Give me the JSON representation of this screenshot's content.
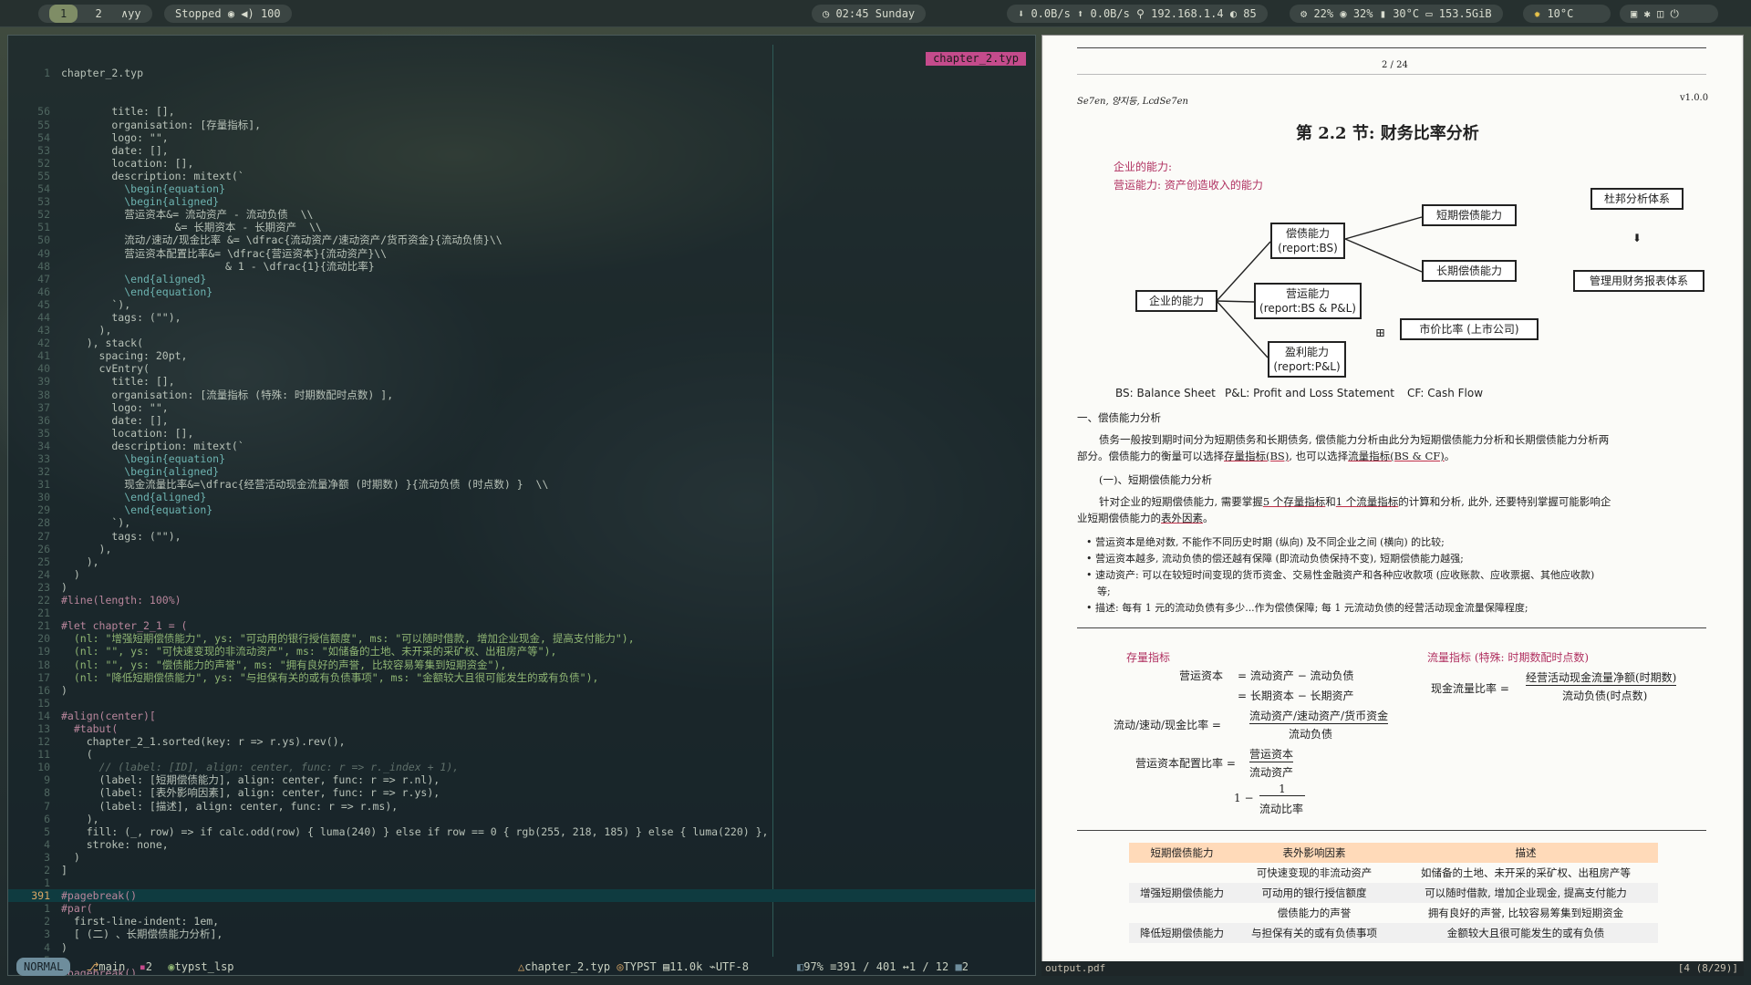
{
  "topbar": {
    "workspaces": [
      "1",
      "2"
    ],
    "layout": "∧yy",
    "music": {
      "status": "Stopped",
      "volume": "100"
    },
    "clock": "02:45 Sunday",
    "network": {
      "down": "0.0B/s",
      "up": "0.0B/s",
      "ip": "192.168.1.4",
      "battery": "85"
    },
    "system": {
      "cpu": "22%",
      "mem": "32%",
      "temp": "30°C",
      "disk": "153.5GiB"
    },
    "weather": "10°C"
  },
  "editor": {
    "filename": "chapter_2.typ",
    "first_line": "chapter_2.typ",
    "lines": [
      {
        "n": "56",
        "t": "        title: [],"
      },
      {
        "n": "55",
        "t": "        organisation: [存量指标],"
      },
      {
        "n": "54",
        "t": "        logo: \"\","
      },
      {
        "n": "53",
        "t": "        date: [],"
      },
      {
        "n": "52",
        "t": "        location: [],"
      },
      {
        "n": "55",
        "t": "        description: mitext(`"
      },
      {
        "n": "54",
        "t": "          \\begin{equation}"
      },
      {
        "n": "53",
        "t": "          \\begin{aligned}"
      },
      {
        "n": "52",
        "t": "          营运资本&= 流动资产 - 流动负债  \\\\"
      },
      {
        "n": "51",
        "t": "                  &= 长期资本 - 长期资产  \\\\"
      },
      {
        "n": "50",
        "t": "          流动/速动/现金比率 &= \\dfrac{流动资产/速动资产/货币资金}{流动负债}\\\\"
      },
      {
        "n": "49",
        "t": "          营运资本配置比率&= \\dfrac{营运资本}{流动资产}\\\\"
      },
      {
        "n": "48",
        "t": "                          & 1 - \\dfrac{1}{流动比率}"
      },
      {
        "n": "47",
        "t": "          \\end{aligned}"
      },
      {
        "n": "46",
        "t": "          \\end{equation}"
      },
      {
        "n": "45",
        "t": "        `),"
      },
      {
        "n": "44",
        "t": "        tags: (\"\"),"
      },
      {
        "n": "43",
        "t": "      ),"
      },
      {
        "n": "42",
        "t": "    ), stack("
      },
      {
        "n": "41",
        "t": "      spacing: 20pt,"
      },
      {
        "n": "40",
        "t": "      cvEntry("
      },
      {
        "n": "39",
        "t": "        title: [],"
      },
      {
        "n": "38",
        "t": "        organisation: [流量指标 (特殊: 时期数配时点数) ],"
      },
      {
        "n": "37",
        "t": "        logo: \"\","
      },
      {
        "n": "36",
        "t": "        date: [],"
      },
      {
        "n": "35",
        "t": "        location: [],"
      },
      {
        "n": "34",
        "t": "        description: mitext(`"
      },
      {
        "n": "33",
        "t": "          \\begin{equation}"
      },
      {
        "n": "32",
        "t": "          \\begin{aligned}"
      },
      {
        "n": "31",
        "t": "          现金流量比率&=\\dfrac{经营活动现金流量净额 (时期数) }{流动负债 (时点数) }  \\\\"
      },
      {
        "n": "30",
        "t": "          \\end{aligned}"
      },
      {
        "n": "29",
        "t": "          \\end{equation}"
      },
      {
        "n": "28",
        "t": "        `),"
      },
      {
        "n": "27",
        "t": "        tags: (\"\"),"
      },
      {
        "n": "26",
        "t": "      ),"
      },
      {
        "n": "25",
        "t": "    ),"
      },
      {
        "n": "24",
        "t": "  )"
      },
      {
        "n": "23",
        "t": ")"
      },
      {
        "n": "22",
        "t": "#line(length: 100%)"
      },
      {
        "n": "21",
        "t": ""
      },
      {
        "n": "21",
        "t": "#let chapter_2_1 = ("
      },
      {
        "n": "20",
        "t": "  (nl: \"增强短期偿债能力\", ys: \"可动用的银行授信额度\", ms: \"可以随时借款, 增加企业现金, 提高支付能力\"),"
      },
      {
        "n": "19",
        "t": "  (nl: \"\", ys: \"可快速变现的非流动资产\", ms: \"如储备的土地、未开采的采矿权、出租房产等\"),"
      },
      {
        "n": "18",
        "t": "  (nl: \"\", ys: \"偿债能力的声誉\", ms: \"拥有良好的声誉, 比较容易筹集到短期资金\"),"
      },
      {
        "n": "17",
        "t": "  (nl: \"降低短期偿债能力\", ys: \"与担保有关的或有负债事项\", ms: \"金额较大且很可能发生的或有负债\"),"
      },
      {
        "n": "16",
        "t": ")"
      },
      {
        "n": "15",
        "t": ""
      },
      {
        "n": "14",
        "t": "#align(center)["
      },
      {
        "n": "13",
        "t": "  #tabut("
      },
      {
        "n": "12",
        "t": "    chapter_2_1.sorted(key: r => r.ys).rev(),"
      },
      {
        "n": "11",
        "t": "    ("
      },
      {
        "n": "10",
        "t": "      // (label: [ID], align: center, func: r => r._index + 1),"
      },
      {
        "n": "9",
        "t": "      (label: [短期偿债能力], align: center, func: r => r.nl),"
      },
      {
        "n": "8",
        "t": "      (label: [表外影响因素], align: center, func: r => r.ys),"
      },
      {
        "n": "7",
        "t": "      (label: [描述], align: center, func: r => r.ms),"
      },
      {
        "n": "6",
        "t": "    ),"
      },
      {
        "n": "5",
        "t": "    fill: (_, row) => if calc.odd(row) { luma(240) } else if row == 0 { rgb(255, 218, 185) } else { luma(220) },"
      },
      {
        "n": "4",
        "t": "    stroke: none,"
      },
      {
        "n": "3",
        "t": "  )"
      },
      {
        "n": "2",
        "t": "]"
      },
      {
        "n": "1",
        "t": ""
      },
      {
        "n": "391",
        "t": "#pagebreak()",
        "current": true
      },
      {
        "n": "1",
        "t": "#par("
      },
      {
        "n": "2",
        "t": "  first-line-indent: 1em,"
      },
      {
        "n": "3",
        "t": "  [ (二) 、长期偿债能力分析],"
      },
      {
        "n": "4",
        "t": ")"
      },
      {
        "n": "5",
        "t": ""
      },
      {
        "n": "6",
        "t": "#pagebreak()"
      },
      {
        "n": "7",
        "t": ""
      },
      {
        "n": "8",
        "t": "== 财务预测的步骤和方法"
      },
      {
        "n": "9",
        "t": ""
      },
      {
        "n": "10",
        "t": "== 增长率与资本需求的测算"
      }
    ]
  },
  "statusline": {
    "mode": "NORMAL",
    "branch": "main",
    "diag": "2",
    "lsp": "typst_lsp",
    "file": "chapter_2.typ",
    "filetype": "TYPST",
    "size": "11.0k",
    "encoding": "UTF-8",
    "percent": "97%",
    "position": "391 / 401",
    "col": "1 / 12",
    "count": "2"
  },
  "viewer": {
    "filename": "output.pdf",
    "page_indicator": "[4 (8/29)]",
    "page": "2 / 24",
    "authors": "Se7en, 양지등, LcdSe7en",
    "version": "v1.0.0",
    "heading": "第 2.2 节: 财务比率分析",
    "intro1": "企业的能力:",
    "intro2": "营运能力: 资产创造收入的能力",
    "diagram": {
      "root": "企业的能力",
      "solvency": "偿债能力",
      "solvency_sub": "(report:BS)",
      "operating": "营运能力",
      "operating_sub": "(report:BS & P&L)",
      "profit": "盈利能力",
      "profit_sub": "(report:P&L)",
      "short": "短期偿债能力",
      "long": "长期偿债能力",
      "market": "市价比率 (上市公司)",
      "dupont": "杜邦分析体系",
      "mgmt": "管理用财务报表体系"
    },
    "legend": [
      "BS: Balance Sheet",
      "P&L: Profit and Loss Statement",
      "CF: Cash Flow"
    ],
    "sec1": "一、偿债能力分析",
    "p1a": "债务一般按到期时间分为短期债务和长期债务, 偿债能力分析由此分为短期偿债能力分析和长期偿债能力分析两",
    "p1b": "部分。偿债能力的衡量可以选择",
    "p1c": "存量指标(BS)",
    "p1d": ", 也可以选择",
    "p1e": "流量指标(BS & CF)",
    "p1f": "。",
    "sub1": "(一)、短期偿债能力分析",
    "p2a": "针对企业的短期偿债能力, 需要掌握",
    "p2b": "5 个存量指标",
    "p2c": "和",
    "p2d": "1 个流量指标",
    "p2e": "的计算和分析, 此外, 还要特别掌握可能影响企",
    "p2f": "业短期偿债能力的",
    "p2g": "表外因素",
    "p2h": "。",
    "bullets": [
      "营运资本是绝对数, 不能作不同历史时期 (纵向) 及不同企业之间 (横向) 的比较;",
      "营运资本越多, 流动负债的偿还越有保障 (即流动负债保持不变), 短期偿债能力越强;",
      "速动资产: 可以在较短时间变现的货币资金、交易性金融资产和各种应收款项 (应收账款、应收票据、其他应收款)",
      "描述: 每有 1 元的流动负债有多少...作为偿债保障; 每 1 元流动负债的经营活动现金流量保障程度;"
    ],
    "bullet3_cont": "等;",
    "stock_title": "存量指标",
    "flow_title": "流量指标 (特殊: 时期数配时点数)",
    "eq": {
      "wc": "营运资本",
      "wc1": "流动资产 − 流动负债",
      "wc2": "长期资本 − 长期资产",
      "ratio": "流动/速动/现金比率",
      "ratio_num": "流动资产/速动资产/货币资金",
      "ratio_den": "流动负债",
      "cfg": "营运资本配置比率",
      "cfg_num": "营运资本",
      "cfg_den": "流动资产",
      "one_minus": "1 −",
      "one": "1",
      "cr": "流动比率",
      "cf": "现金流量比率",
      "cf_num": "经营活动现金流量净额(时期数)",
      "cf_den": "流动负债(时点数)"
    },
    "table": {
      "headers": [
        "短期偿债能力",
        "表外影响因素",
        "描述"
      ],
      "rows": [
        [
          "",
          "可快速变现的非流动资产",
          "如储备的土地、未开采的采矿权、出租房产等"
        ],
        [
          "增强短期偿债能力",
          "可动用的银行授信额度",
          "可以随时借款, 增加企业现金, 提高支付能力"
        ],
        [
          "",
          "偿债能力的声誉",
          "拥有良好的声誉, 比较容易筹集到短期资金"
        ],
        [
          "降低短期偿债能力",
          "与担保有关的或有负债事项",
          "金额较大且很可能发生的或有负债"
        ]
      ]
    }
  }
}
